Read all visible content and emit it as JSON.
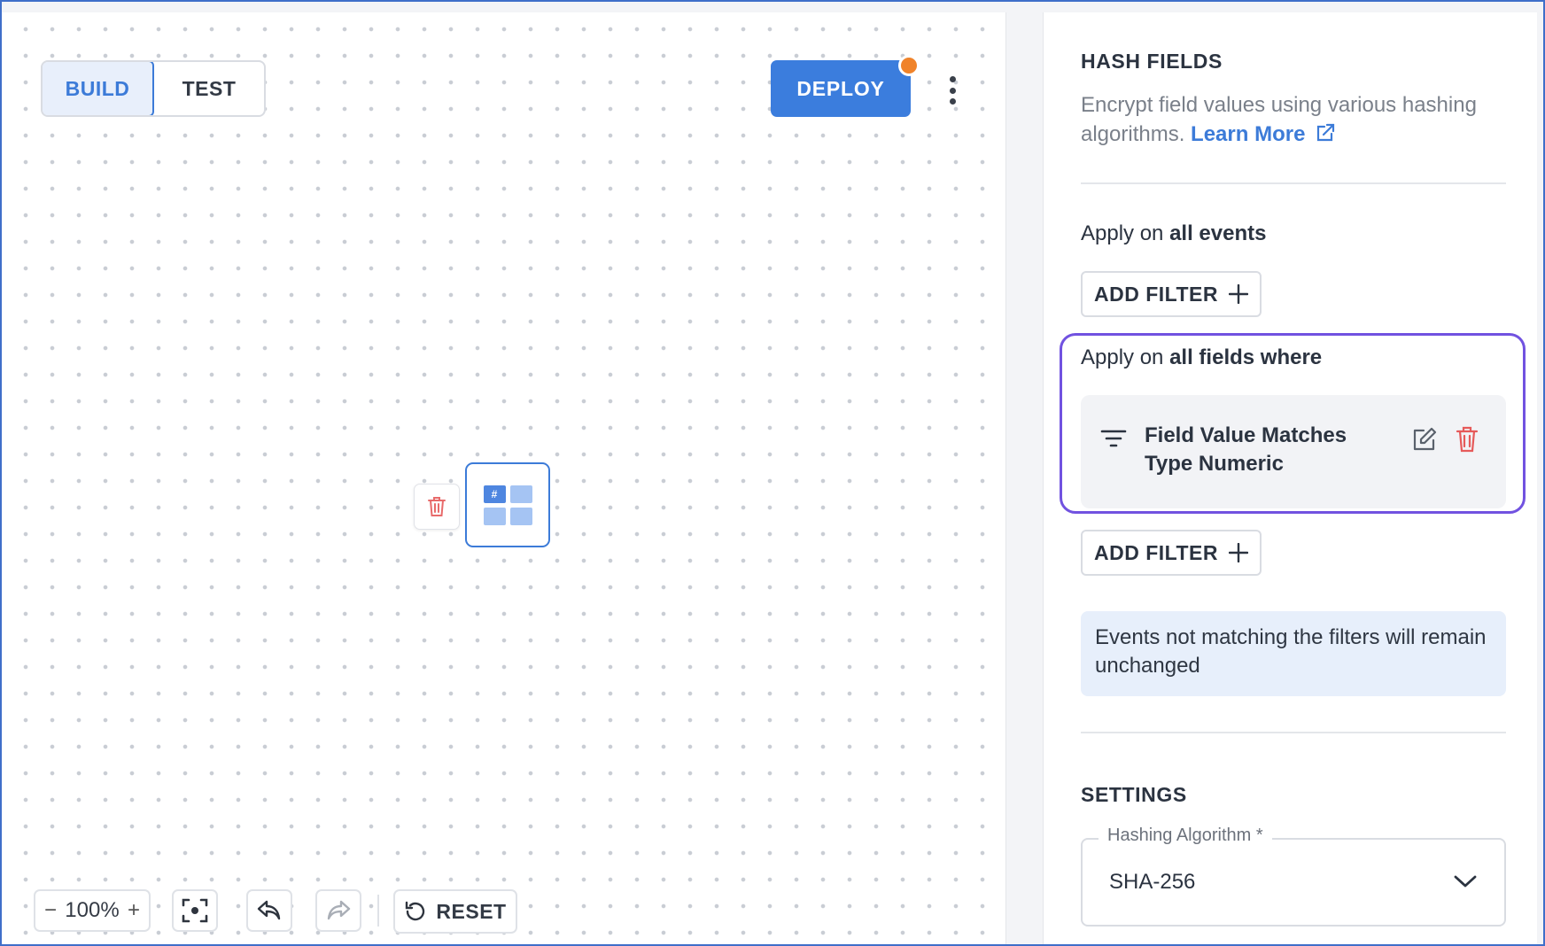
{
  "canvas": {
    "mode_tabs": [
      {
        "label": "BUILD",
        "active": true
      },
      {
        "label": "TEST",
        "active": false
      }
    ],
    "deploy_label": "DEPLOY",
    "zoom_level": "100%",
    "zoom_out_symbol": "−",
    "zoom_in_symbol": "+",
    "reset_label": "RESET",
    "node_hash_glyph": "#"
  },
  "panel": {
    "title": "HASH FIELDS",
    "description": "Encrypt field values using various hashing algorithms.",
    "learn_more": "Learn More",
    "apply_events_prefix": "Apply on",
    "apply_events_strong": "all events",
    "add_filter_label": "ADD FILTER",
    "apply_fields_prefix": "Apply on",
    "apply_fields_strong": "all fields where",
    "filter": {
      "line1": "Field Value Matches",
      "line2": "Type Numeric"
    },
    "add_filter_label_2": "ADD FILTER",
    "info_text": "Events not matching the filters will remain unchanged",
    "settings_title": "SETTINGS",
    "hashing_label": "Hashing Algorithm *",
    "hashing_value": "SHA-256"
  },
  "colors": {
    "accent": "#3b7ddd",
    "deploy_badge": "#f0832a",
    "highlight": "#7152e0",
    "delete_red": "#e65a5a"
  },
  "icons": [
    "three-dots-vertical-icon",
    "trash-icon",
    "hash-grid-node-icon",
    "fit-to-screen-icon",
    "undo-icon",
    "redo-icon",
    "reset-icon",
    "external-link-icon",
    "plus-icon",
    "filter-lines-icon",
    "edit-icon",
    "chevron-down-icon"
  ]
}
